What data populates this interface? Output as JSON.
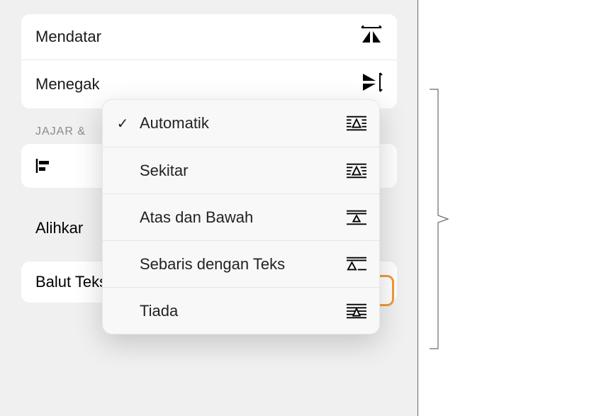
{
  "flip": {
    "horizontal_label": "Mendatar",
    "vertical_label": "Menegak"
  },
  "section": {
    "align_title_visible": "JAJAR &"
  },
  "move_with": {
    "label_visible": "Alihkar"
  },
  "wrap": {
    "label": "Balut Teks",
    "selected": "Automatik"
  },
  "popup": {
    "items": [
      {
        "label": "Automatik",
        "selected": true,
        "icon": "wrap-auto"
      },
      {
        "label": "Sekitar",
        "selected": false,
        "icon": "wrap-around"
      },
      {
        "label": "Atas dan Bawah",
        "selected": false,
        "icon": "wrap-topbottom"
      },
      {
        "label": "Sebaris dengan Teks",
        "selected": false,
        "icon": "wrap-inline"
      },
      {
        "label": "Tiada",
        "selected": false,
        "icon": "wrap-none"
      }
    ]
  },
  "checkmark": "✓"
}
